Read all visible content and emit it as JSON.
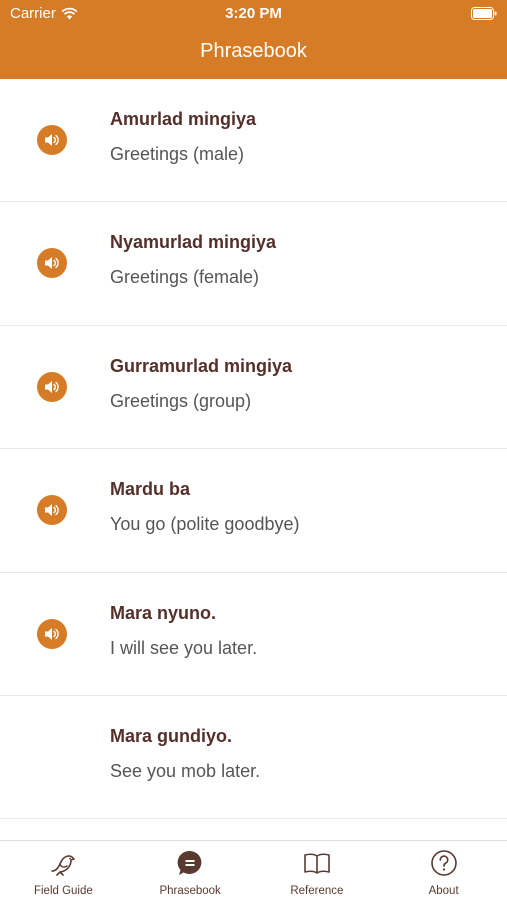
{
  "status_bar": {
    "carrier": "Carrier",
    "time": "3:20 PM"
  },
  "nav": {
    "title": "Phrasebook"
  },
  "colors": {
    "accent": "#d67c27",
    "phrase_text": "#55302a",
    "translation_text": "#555555"
  },
  "phrases": [
    {
      "phrase": "Amurlad mingiya",
      "translation": "Greetings (male)",
      "has_audio": true
    },
    {
      "phrase": "Nyamurlad mingiya",
      "translation": "Greetings (female)",
      "has_audio": true
    },
    {
      "phrase": "Gurramurlad mingiya",
      "translation": "Greetings (group)",
      "has_audio": true
    },
    {
      "phrase": "Mardu ba",
      "translation": "You go (polite goodbye)",
      "has_audio": true
    },
    {
      "phrase": "Mara nyuno.",
      "translation": "I will see you later.",
      "has_audio": true
    },
    {
      "phrase": "Mara gundiyo.",
      "translation": "See you mob later.",
      "has_audio": false
    }
  ],
  "tabs": [
    {
      "label": "Field Guide",
      "icon": "bird-icon",
      "selected": false
    },
    {
      "label": "Phrasebook",
      "icon": "speech-bubble-icon",
      "selected": true
    },
    {
      "label": "Reference",
      "icon": "book-icon",
      "selected": false
    },
    {
      "label": "About",
      "icon": "question-circle-icon",
      "selected": false
    }
  ]
}
